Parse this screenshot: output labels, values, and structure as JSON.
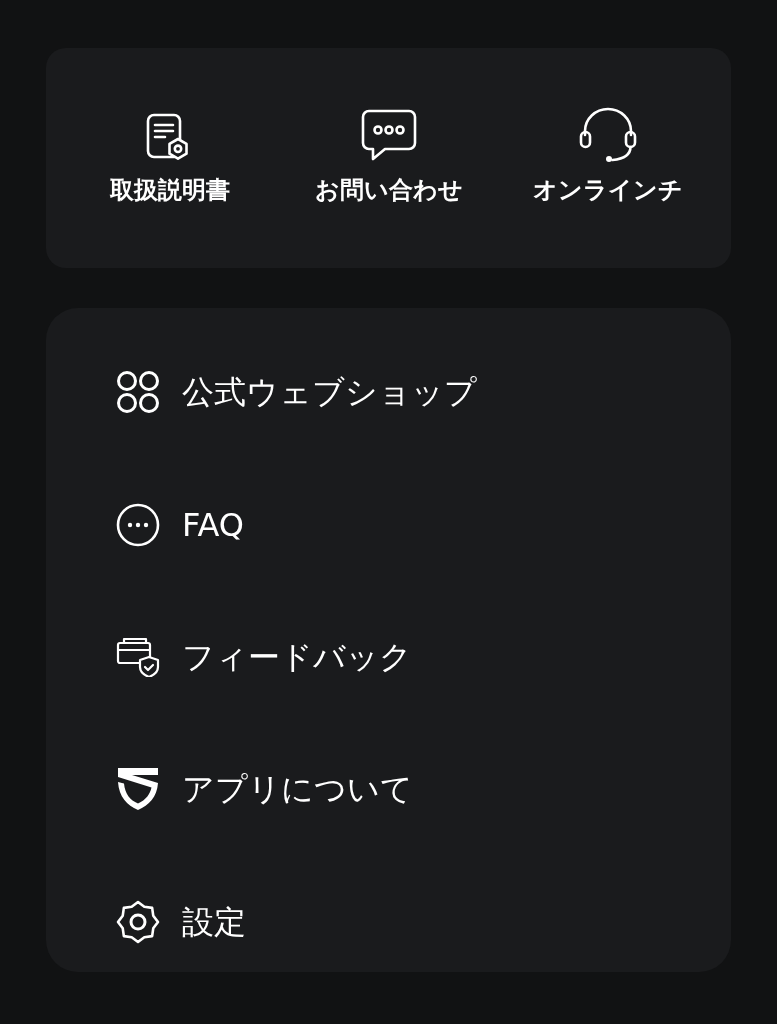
{
  "quick_actions": [
    {
      "label": "取扱説明書"
    },
    {
      "label": "お問い合わせ"
    },
    {
      "label": "オンラインチ"
    }
  ],
  "menu": [
    {
      "label": "公式ウェブショップ"
    },
    {
      "label": "FAQ"
    },
    {
      "label": "フィードバック"
    },
    {
      "label": "アプリについて"
    },
    {
      "label": "設定"
    }
  ]
}
